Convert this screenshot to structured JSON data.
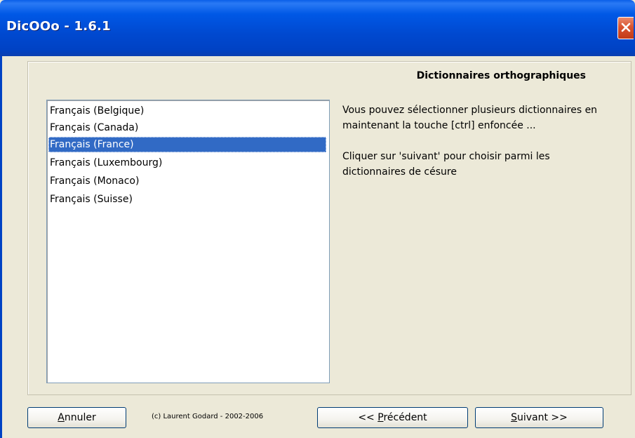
{
  "window": {
    "title": "DicOOo - 1.6.1"
  },
  "panel": {
    "heading": "Dictionnaires orthographiques",
    "list_items": [
      "Français (Belgique)",
      "Français (Canada)",
      "Français (France)",
      "Français (Luxembourg)",
      "Français (Monaco)",
      "Français (Suisse)"
    ],
    "selected_item": "Français (France)",
    "description_1": "Vous pouvez sélectionner plusieurs dictionnaires en maintenant la touche [ctrl] enfoncée ...",
    "description_2": "Cliquer sur 'suivant' pour choisir parmi les dictionnaires de césure"
  },
  "footer": {
    "cancel": {
      "mnemonic": "A",
      "rest": "nnuler"
    },
    "copyright": "(c) Laurent Godard - 2002-2006",
    "previous": {
      "prefix": "<< ",
      "mnemonic": "P",
      "rest": "récédent"
    },
    "next": {
      "mnemonic": "S",
      "rest": "uivant >>"
    }
  },
  "colors": {
    "title_bar": "#0054e3",
    "selection": "#316ac5",
    "close_button": "#d9532f",
    "dialog_background": "#ece9d8"
  },
  "icons": {
    "close": "close-icon"
  }
}
